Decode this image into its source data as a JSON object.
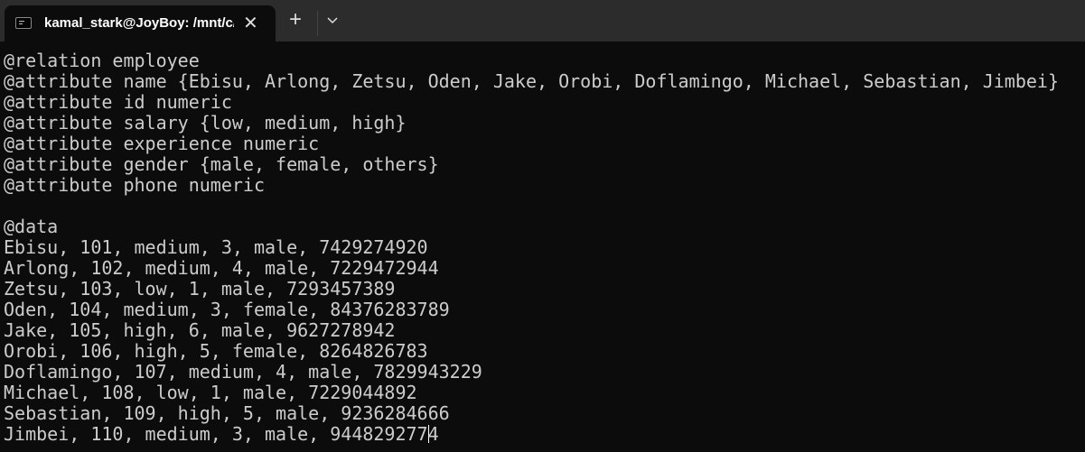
{
  "tab": {
    "title": "kamal_stark@JoyBoy: /mnt/c/",
    "close": "✕",
    "new_tab": "+"
  },
  "lines": [
    "@relation employee",
    "@attribute name {Ebisu, Arlong, Zetsu, Oden, Jake, Orobi, Doflamingo, Michael, Sebastian, Jimbei}",
    "@attribute id numeric",
    "@attribute salary {low, medium, high}",
    "@attribute experience numeric",
    "@attribute gender {male, female, others}",
    "@attribute phone numeric",
    "",
    "@data",
    "Ebisu, 101, medium, 3, male, 7429274920",
    "Arlong, 102, medium, 4, male, 7229472944",
    "Zetsu, 103, low, 1, male, 7293457389",
    "Oden, 104, medium, 3, female, 84376283789",
    "Jake, 105, high, 6, male, 9627278942",
    "Orobi, 106, high, 5, female, 8264826783",
    "Doflamingo, 107, medium, 4, male, 7829943229",
    "Michael, 108, low, 1, male, 7229044892",
    "Sebastian, 109, high, 5, male, 9236284666"
  ],
  "last_line": {
    "before_cursor": "Jimbei, 110, medium, 3, male, 944829277",
    "after_cursor": "4"
  }
}
